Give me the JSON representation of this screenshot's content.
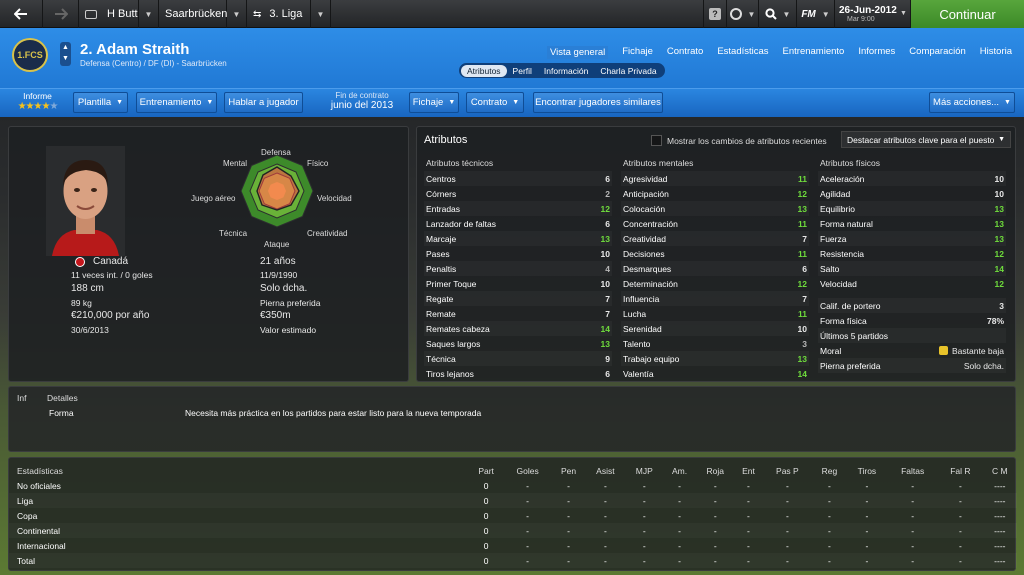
{
  "topbar": {
    "manager": "H Butt",
    "club": "Saarbrücken",
    "competition": "3. Liga",
    "fm_label": "FM",
    "date": "26-Jun-2012",
    "weekday_time": "Mar 9:00",
    "continue_label": "Continuar"
  },
  "header": {
    "player_title": "2. Adam Straith",
    "position_club": "Defensa (Centro) / DF (DI) - Saarbrücken",
    "crest_text": "1.FCS",
    "main_tabs": [
      "Vista general",
      "Fichaje",
      "Contrato",
      "Estadísticas",
      "Entrenamiento",
      "Informes",
      "Comparación",
      "Historia"
    ],
    "sub_tabs": [
      "Atributos",
      "Perfil",
      "Información",
      "Charla Privada"
    ]
  },
  "buttons": {
    "informe_label": "Informe",
    "stars": "★★★★",
    "plantilla": "Plantilla",
    "entrenamiento": "Entrenamiento",
    "hablar": "Hablar a jugador",
    "contract_label": "Fin de contrato",
    "contract_value": "junio del 2013",
    "fichaje": "Fichaje",
    "contrato": "Contrato",
    "similares": "Encontrar jugadores similares",
    "mas": "Más acciones..."
  },
  "radar": {
    "labels": [
      "Defensa",
      "Físico",
      "Velocidad",
      "Creatividad",
      "Ataque",
      "Técnica",
      "Juego aéreo",
      "Mental"
    ]
  },
  "player": {
    "nation": "Canadá",
    "caps": "11 veces int. / 0 goles",
    "height": "188 cm",
    "weight": "89 kg",
    "wage": "€210,000 por año",
    "contract_end": "30/6/2013",
    "age": "21 años",
    "dob": "11/9/1990",
    "foot": "Solo dcha.",
    "foot_label": "Pierna preferida",
    "value": "€350m",
    "value_label": "Valor estimado"
  },
  "attributes": {
    "title": "Atributos",
    "show_changes": "Mostrar los cambios de atributos recientes",
    "highlight": "Destacar atributos clave para el puesto",
    "technical_title": "Atributos técnicos",
    "technical": [
      {
        "name": "Centros",
        "value": "6"
      },
      {
        "name": "Córners",
        "value": "2"
      },
      {
        "name": "Entradas",
        "value": "12"
      },
      {
        "name": "Lanzador de faltas",
        "value": "6"
      },
      {
        "name": "Marcaje",
        "value": "13"
      },
      {
        "name": "Pases",
        "value": "10"
      },
      {
        "name": "Penaltis",
        "value": "4"
      },
      {
        "name": "Primer Toque",
        "value": "10"
      },
      {
        "name": "Regate",
        "value": "7"
      },
      {
        "name": "Remate",
        "value": "7"
      },
      {
        "name": "Remates cabeza",
        "value": "14"
      },
      {
        "name": "Saques largos",
        "value": "13"
      },
      {
        "name": "Técnica",
        "value": "9"
      },
      {
        "name": "Tiros lejanos",
        "value": "6"
      }
    ],
    "mental_title": "Atributos mentales",
    "mental": [
      {
        "name": "Agresividad",
        "value": "11"
      },
      {
        "name": "Anticipación",
        "value": "12"
      },
      {
        "name": "Colocación",
        "value": "13"
      },
      {
        "name": "Concentración",
        "value": "11"
      },
      {
        "name": "Creatividad",
        "value": "7"
      },
      {
        "name": "Decisiones",
        "value": "11"
      },
      {
        "name": "Desmarques",
        "value": "6"
      },
      {
        "name": "Determinación",
        "value": "12"
      },
      {
        "name": "Influencia",
        "value": "7"
      },
      {
        "name": "Lucha",
        "value": "11"
      },
      {
        "name": "Serenidad",
        "value": "10"
      },
      {
        "name": "Talento",
        "value": "3"
      },
      {
        "name": "Trabajo equipo",
        "value": "13"
      },
      {
        "name": "Valentía",
        "value": "14"
      }
    ],
    "physical_title": "Atributos físicos",
    "physical": [
      {
        "name": "Aceleración",
        "value": "10"
      },
      {
        "name": "Agilidad",
        "value": "10"
      },
      {
        "name": "Equilibrio",
        "value": "13"
      },
      {
        "name": "Forma natural",
        "value": "13"
      },
      {
        "name": "Fuerza",
        "value": "13"
      },
      {
        "name": "Resistencia",
        "value": "12"
      },
      {
        "name": "Salto",
        "value": "14"
      },
      {
        "name": "Velocidad",
        "value": "12"
      }
    ],
    "extra": [
      {
        "name": "Calif. de portero",
        "value": "3"
      },
      {
        "name": "Forma física",
        "value": "78%"
      },
      {
        "name": "Últimos 5 partidos",
        "value": ""
      },
      {
        "name": "Moral",
        "value": "Bastante baja"
      },
      {
        "name": "Pierna preferida",
        "value": "Solo dcha."
      }
    ]
  },
  "info": {
    "col1": "Inf",
    "col2": "Detalles",
    "row_label": "Forma",
    "row_text": "Necesita más práctica en los partidos para estar listo para la nueva temporada"
  },
  "stats": {
    "title": "Estadísticas",
    "columns": [
      "Part",
      "Goles",
      "Pen",
      "Asist",
      "MJP",
      "Am.",
      "Roja",
      "Ent",
      "Pas P",
      "Reg",
      "Tiros",
      "Faltas",
      "Fal R",
      "C M"
    ],
    "rows": [
      {
        "label": "No oficiales",
        "values": [
          "0",
          "-",
          "-",
          "-",
          "-",
          "-",
          "-",
          "-",
          "-",
          "-",
          "-",
          "-",
          "-",
          "----"
        ]
      },
      {
        "label": "Liga",
        "values": [
          "0",
          "-",
          "-",
          "-",
          "-",
          "-",
          "-",
          "-",
          "-",
          "-",
          "-",
          "-",
          "-",
          "----"
        ]
      },
      {
        "label": "Copa",
        "values": [
          "0",
          "-",
          "-",
          "-",
          "-",
          "-",
          "-",
          "-",
          "-",
          "-",
          "-",
          "-",
          "-",
          "----"
        ]
      },
      {
        "label": "Continental",
        "values": [
          "0",
          "-",
          "-",
          "-",
          "-",
          "-",
          "-",
          "-",
          "-",
          "-",
          "-",
          "-",
          "-",
          "----"
        ]
      },
      {
        "label": "Internacional",
        "values": [
          "0",
          "-",
          "-",
          "-",
          "-",
          "-",
          "-",
          "-",
          "-",
          "-",
          "-",
          "-",
          "-",
          "----"
        ]
      },
      {
        "label": "Total",
        "values": [
          "0",
          "-",
          "-",
          "-",
          "-",
          "-",
          "-",
          "-",
          "-",
          "-",
          "-",
          "-",
          "-",
          "----"
        ]
      }
    ]
  },
  "colors": {
    "accent_blue": "#2e8de7",
    "highlight_green": "#6fdc3c",
    "continue_green": "#4a9a32",
    "star": "#f6c21c"
  }
}
